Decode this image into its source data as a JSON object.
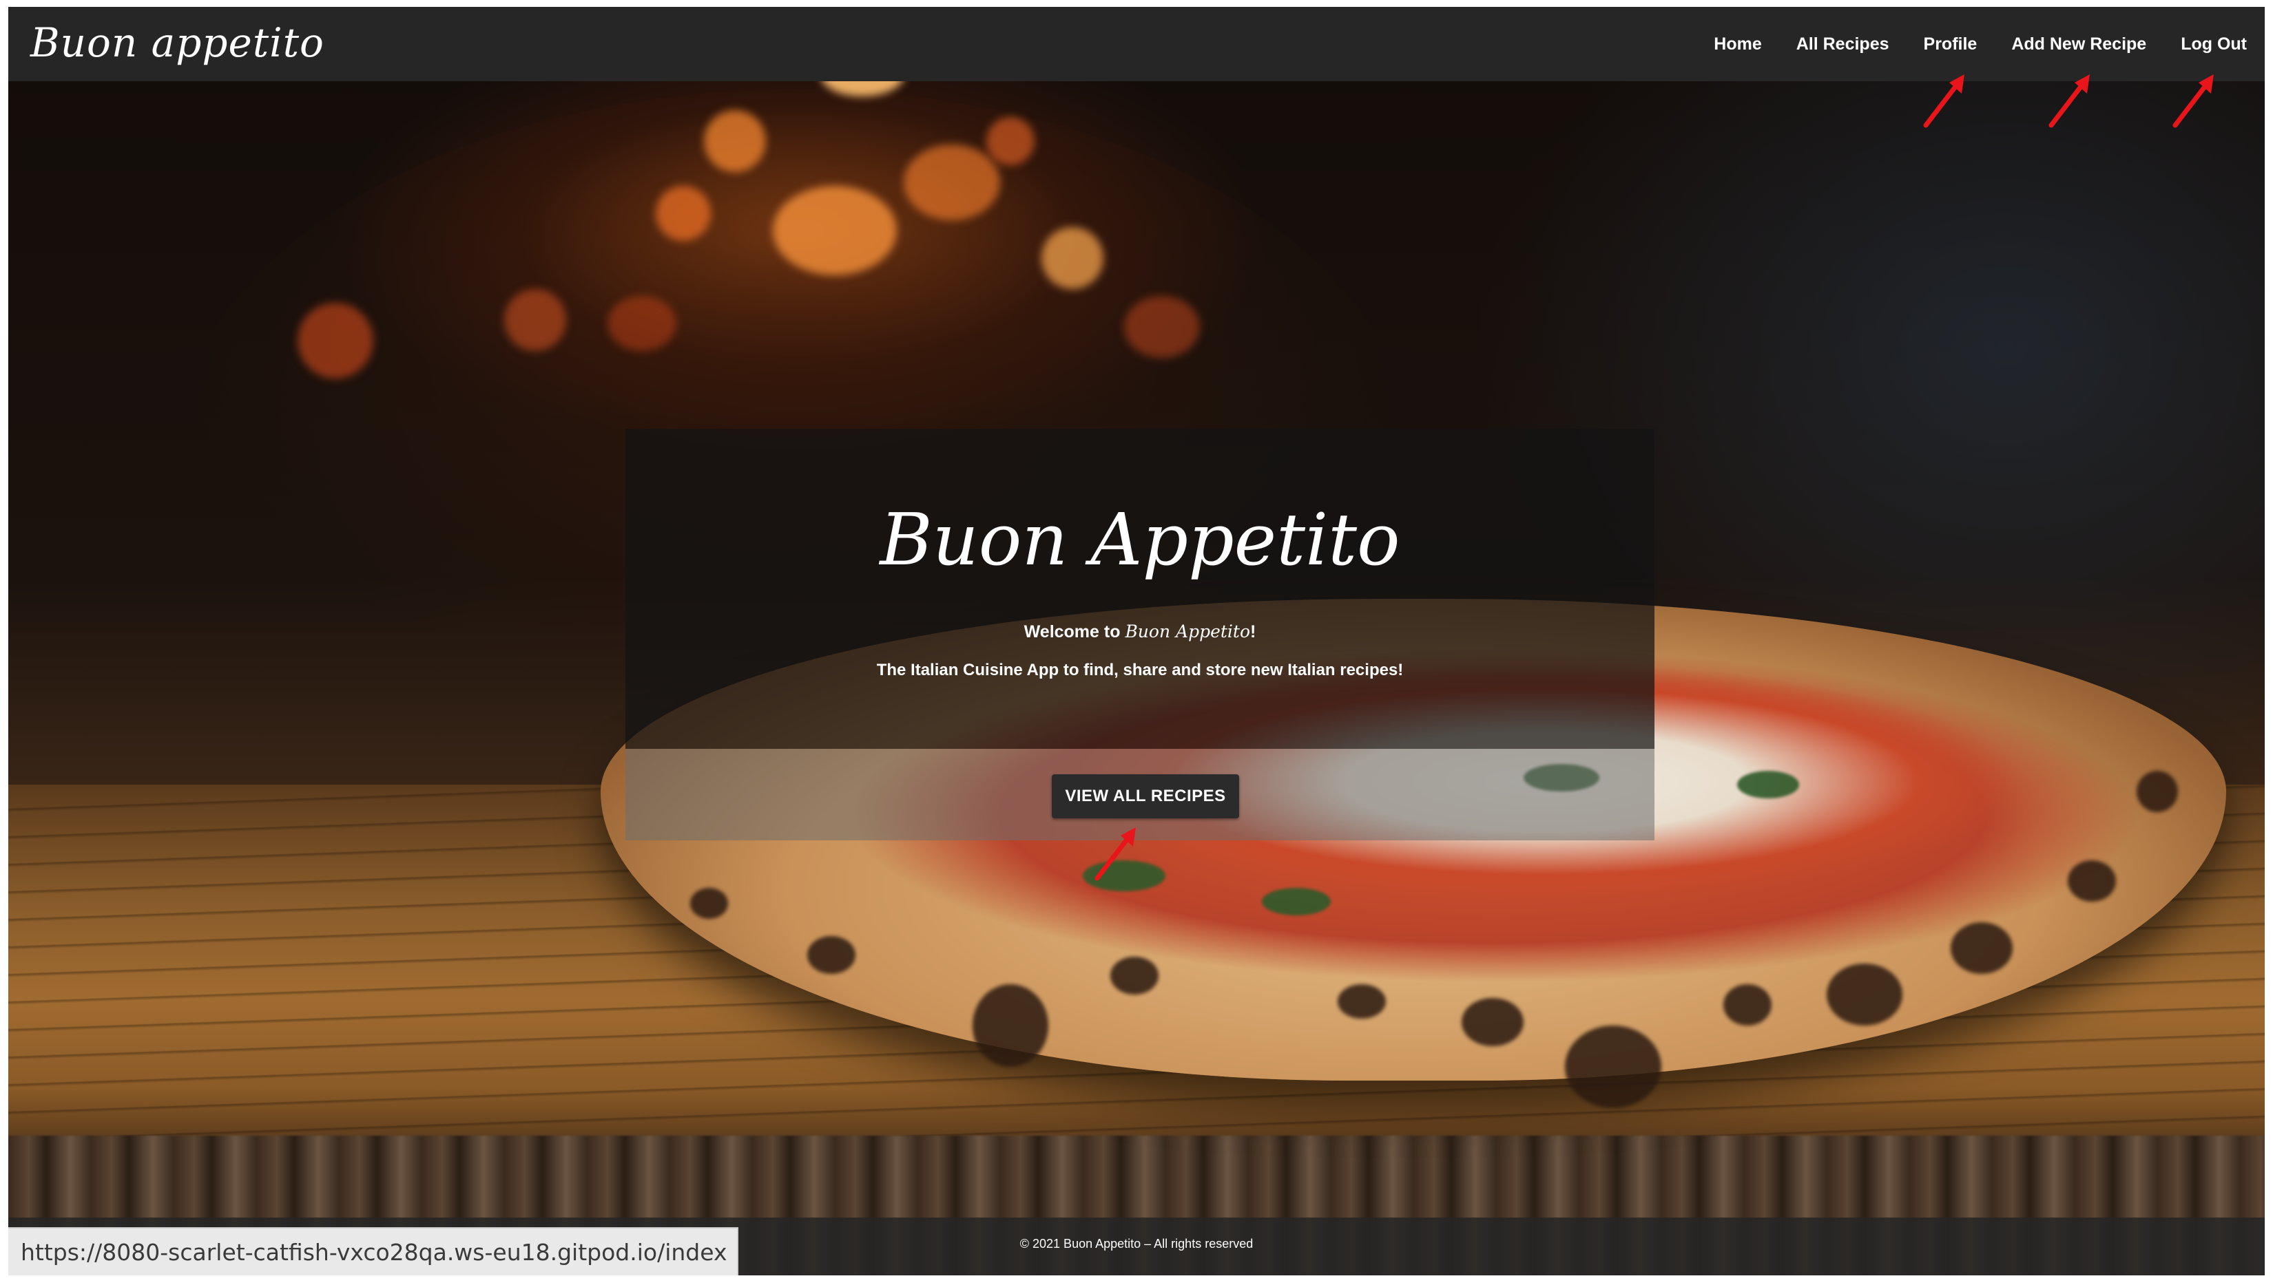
{
  "app": {
    "brand": "Buon appetito"
  },
  "nav": {
    "items": [
      {
        "label": "Home"
      },
      {
        "label": "All Recipes"
      },
      {
        "label": "Profile"
      },
      {
        "label": "Add New Recipe"
      },
      {
        "label": "Log Out"
      }
    ]
  },
  "hero": {
    "title": "Buon Appetito",
    "welcome_prefix": "Welcome to ",
    "welcome_name": "Buon Appetito",
    "welcome_suffix": "!",
    "tagline": "The Italian Cuisine App to find, share and store new Italian recipes!",
    "cta_label": "VIEW ALL RECIPES"
  },
  "footer": {
    "text": "© 2021 Buon Appetito – All rights reserved"
  },
  "status_bar": {
    "url": "https://8080-scarlet-catfish-vxco28qa.ws-eu18.gitpod.io/index"
  },
  "colors": {
    "navbar": "#262626",
    "annotation_arrow": "#e8161b",
    "button": "#2b2b2b"
  }
}
